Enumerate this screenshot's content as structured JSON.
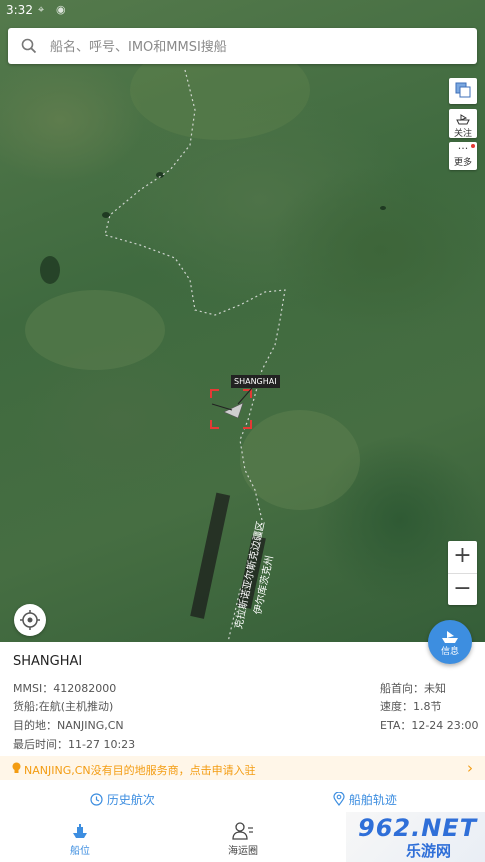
{
  "status_bar": {
    "time": "3:32"
  },
  "search": {
    "placeholder": "船名、呼号、IMO和MMSI搜船"
  },
  "side_buttons": {
    "follow": "关注",
    "more": "更多"
  },
  "map": {
    "ship_label": "SHANGHAI",
    "region_label_1": "克拉斯诺亚尔斯克边疆区",
    "region_label_2": "伊尔库茨克州"
  },
  "fab": {
    "info_label": "信息"
  },
  "ship": {
    "name": "SHANGHAI",
    "mmsi": "MMSI：412082000",
    "status": "货船;在航(主机推动)",
    "destination": "目的地：NANJING,CN",
    "last_time": "最后时间：11-27 10:23",
    "heading": "船首向：未知",
    "speed": "速度：1.8节",
    "eta": "ETA：12-24 23:00"
  },
  "notice": {
    "text": "NANJING,CN没有目的地服务商，点击申请入驻"
  },
  "actions": {
    "history": "历史航次",
    "track": "船舶轨迹"
  },
  "tabs": {
    "ship_position": "船位",
    "shipping_chart": "海运圈"
  },
  "watermark": {
    "brand": "962.NET",
    "sub": "乐游网"
  },
  "colors": {
    "accent": "#3d8ee0",
    "notice": "#f39c12",
    "target": "#e53935"
  }
}
